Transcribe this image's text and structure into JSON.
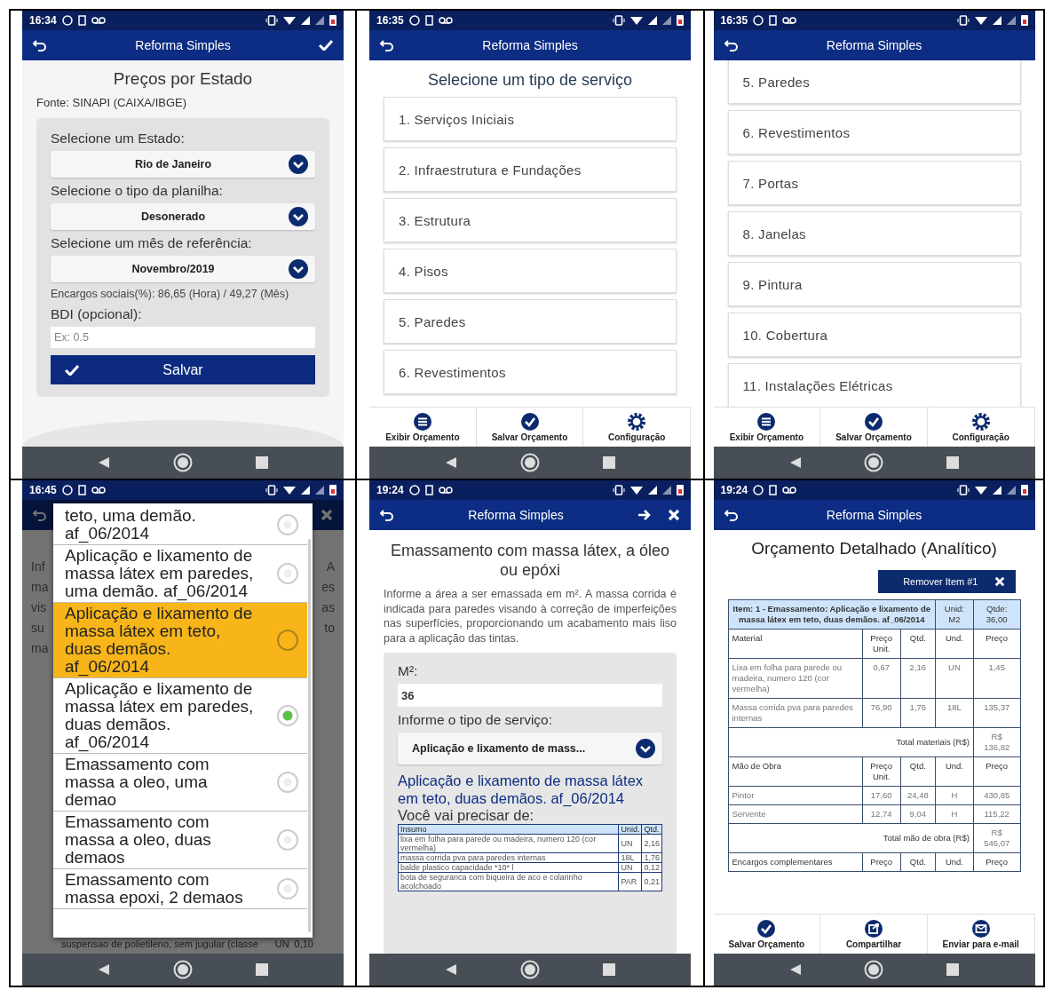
{
  "panels": [
    {
      "kind": "state_form",
      "status": {
        "time": "16:34"
      },
      "app_bar": {
        "title": "Reforma Simples",
        "actions": [
          {
            "kind": "check"
          }
        ]
      },
      "heading": "Preços por Estado",
      "source": "Fonte: SINAPI (CAIXA/IBGE)",
      "fields": [
        {
          "label": "Selecione um Estado:",
          "value": "Rio de Janeiro"
        },
        {
          "label": "Selecione o tipo da planilha:",
          "value": "Desonerado"
        },
        {
          "label": "Selecione um mês de referência:",
          "value": "Novembro/2019"
        }
      ],
      "note": "Encargos sociais(%): 86,65 (Hora) / 49,27 (Mês)",
      "bdi": {
        "label": "BDI (opcional):",
        "placeholder": "Ex: 0.5"
      },
      "save_button": "Salvar"
    },
    {
      "kind": "service_list",
      "status": {
        "time": "16:35"
      },
      "app_bar": {
        "title": "Reforma Simples"
      },
      "heading": "Selecione um tipo de serviço",
      "items": [
        "1. Serviços Iniciais",
        "2. Infraestrutura e Fundações",
        "3. Estrutura",
        "4. Pisos",
        "5. Paredes",
        "6. Revestimentos"
      ],
      "toolbar": [
        {
          "kind": "list",
          "label": "Exibir Orçamento"
        },
        {
          "kind": "check",
          "label": "Salvar Orçamento"
        },
        {
          "kind": "gear",
          "label": "Configuração"
        }
      ]
    },
    {
      "kind": "service_list",
      "status": {
        "time": "16:35"
      },
      "app_bar": {
        "title": "Reforma Simples"
      },
      "items": [
        "5. Paredes",
        "6. Revestimentos",
        "7. Portas",
        "8. Janelas",
        "9. Pintura",
        "10. Cobertura",
        "11. Instalações Elétricas"
      ],
      "toolbar": [
        {
          "kind": "list",
          "label": "Exibir Orçamento"
        },
        {
          "kind": "check",
          "label": "Salvar Orçamento"
        },
        {
          "kind": "gear",
          "label": "Configuração"
        }
      ]
    },
    {
      "kind": "option_dialog",
      "status": {
        "time": "16:45"
      },
      "app_bar": {
        "actions": [
          {
            "kind": "close"
          }
        ]
      },
      "background": {
        "left": [
          "Inf",
          "ma",
          "vis",
          "su",
          "ma"
        ],
        "right": [
          "A",
          "es",
          "as",
          "to"
        ],
        "bottom_row": [
          "suspensao de polietileno, sem jugular (classe",
          "UN",
          "0,10"
        ]
      },
      "options": [
        {
          "label": "teto, uma demão. af_06/2014",
          "highlighted": false,
          "checked": false
        },
        {
          "label": "Aplicação e lixamento de massa látex em paredes, uma demão. af_06/2014",
          "highlighted": false,
          "checked": false
        },
        {
          "label": "Aplicação e lixamento de massa látex em teto, duas demãos. af_06/2014",
          "highlighted": true,
          "checked": false
        },
        {
          "label": "Aplicação e lixamento de massa látex em paredes, duas demãos. af_06/2014",
          "highlighted": false,
          "checked": true
        },
        {
          "label": "Emassamento com massa a oleo, uma demao",
          "highlighted": false,
          "checked": false
        },
        {
          "label": "Emassamento com massa a oleo, duas demaos",
          "highlighted": false,
          "checked": false
        },
        {
          "label": "Emassamento com massa epoxi, 2 demaos",
          "highlighted": false,
          "checked": false
        }
      ]
    },
    {
      "kind": "service_form",
      "status": {
        "time": "19:24"
      },
      "app_bar": {
        "title": "Reforma Simples",
        "actions": [
          {
            "kind": "forward"
          },
          {
            "kind": "close"
          }
        ]
      },
      "heading": "Emassamento com massa látex, a óleo ou epóxi",
      "description": "Informe a área a ser emassada em m². A massa corrida é indicada para paredes visando à correção de imperfeições nas superfícies, proporcionando um acabamento mais liso para a aplicação das tintas.",
      "area": {
        "label": "M²:",
        "value": "36"
      },
      "service": {
        "label": "Informe o tipo de serviço:",
        "value": "Aplicação e lixamento de mass..."
      },
      "selected_service": "Aplicação e lixamento de massa látex em teto, duas demãos. af_06/2014",
      "needs_label": "Você vai precisar de:",
      "table": {
        "columns": [
          "Insumo",
          "Unid.",
          "Qtd."
        ],
        "rows": [
          [
            "lixa em folha para parede ou madeira, numero 120 (cor vermelha)",
            "UN",
            "2,16"
          ],
          [
            "massa corrida pva para paredes internas",
            "18L",
            "1,76"
          ],
          [
            "balde plastico capacidade *10* l",
            "UN",
            "0,12"
          ],
          [
            "bota de seguranca com biqueira de aco e colarinho acolchoado",
            "PAR",
            "0,21"
          ]
        ]
      }
    },
    {
      "kind": "budget",
      "status": {
        "time": "19:24"
      },
      "app_bar": {
        "title": "Reforma Simples"
      },
      "heading": "Orçamento Detalhado (Analítico)",
      "remove_button": "Remover Item #1",
      "item_header": {
        "description": "Item: 1 - Emassamento: Aplicação e lixamento de massa látex em teto, duas demãos. af_06/2014",
        "unit": "Unid: M2",
        "quantity": "Qtde: 36,00"
      },
      "rows": [
        {
          "kind": "section",
          "cells": [
            "Material",
            "Preço Unit.",
            "Qtd.",
            "Und.",
            "Preço"
          ]
        },
        {
          "kind": "data",
          "cells": [
            "Lixa em folha para parede ou madeira, numero 120 (cor vermelha)",
            "0,67",
            "2,16",
            "UN",
            "1,45"
          ]
        },
        {
          "kind": "data",
          "cells": [
            "Massa corrida pva para paredes internas",
            "76,90",
            "1,76",
            "18L",
            "135,37"
          ]
        },
        {
          "kind": "total",
          "label": "Total materiais (R$)",
          "value": "R$ 136,82"
        },
        {
          "kind": "section",
          "cells": [
            "Mão de Obra",
            "Preço Unit.",
            "Qtd.",
            "Und.",
            "Preço"
          ]
        },
        {
          "kind": "data",
          "cells": [
            "Pintor",
            "17,60",
            "24,48",
            "H",
            "430,85"
          ]
        },
        {
          "kind": "data",
          "cells": [
            "Servente",
            "12,74",
            "9,04",
            "H",
            "115,22"
          ]
        },
        {
          "kind": "total",
          "label": "Total mão de obra (R$)",
          "value": "R$ 546,07"
        },
        {
          "kind": "section",
          "cells": [
            "Encargos complementares",
            "Preço",
            "Qtd.",
            "Und.",
            "Preço"
          ]
        }
      ],
      "toolbar": [
        {
          "kind": "check",
          "label": "Salvar Orçamento"
        },
        {
          "kind": "share",
          "label": "Compartilhar"
        },
        {
          "kind": "mail",
          "label": "Enviar para e-mail"
        }
      ]
    }
  ]
}
